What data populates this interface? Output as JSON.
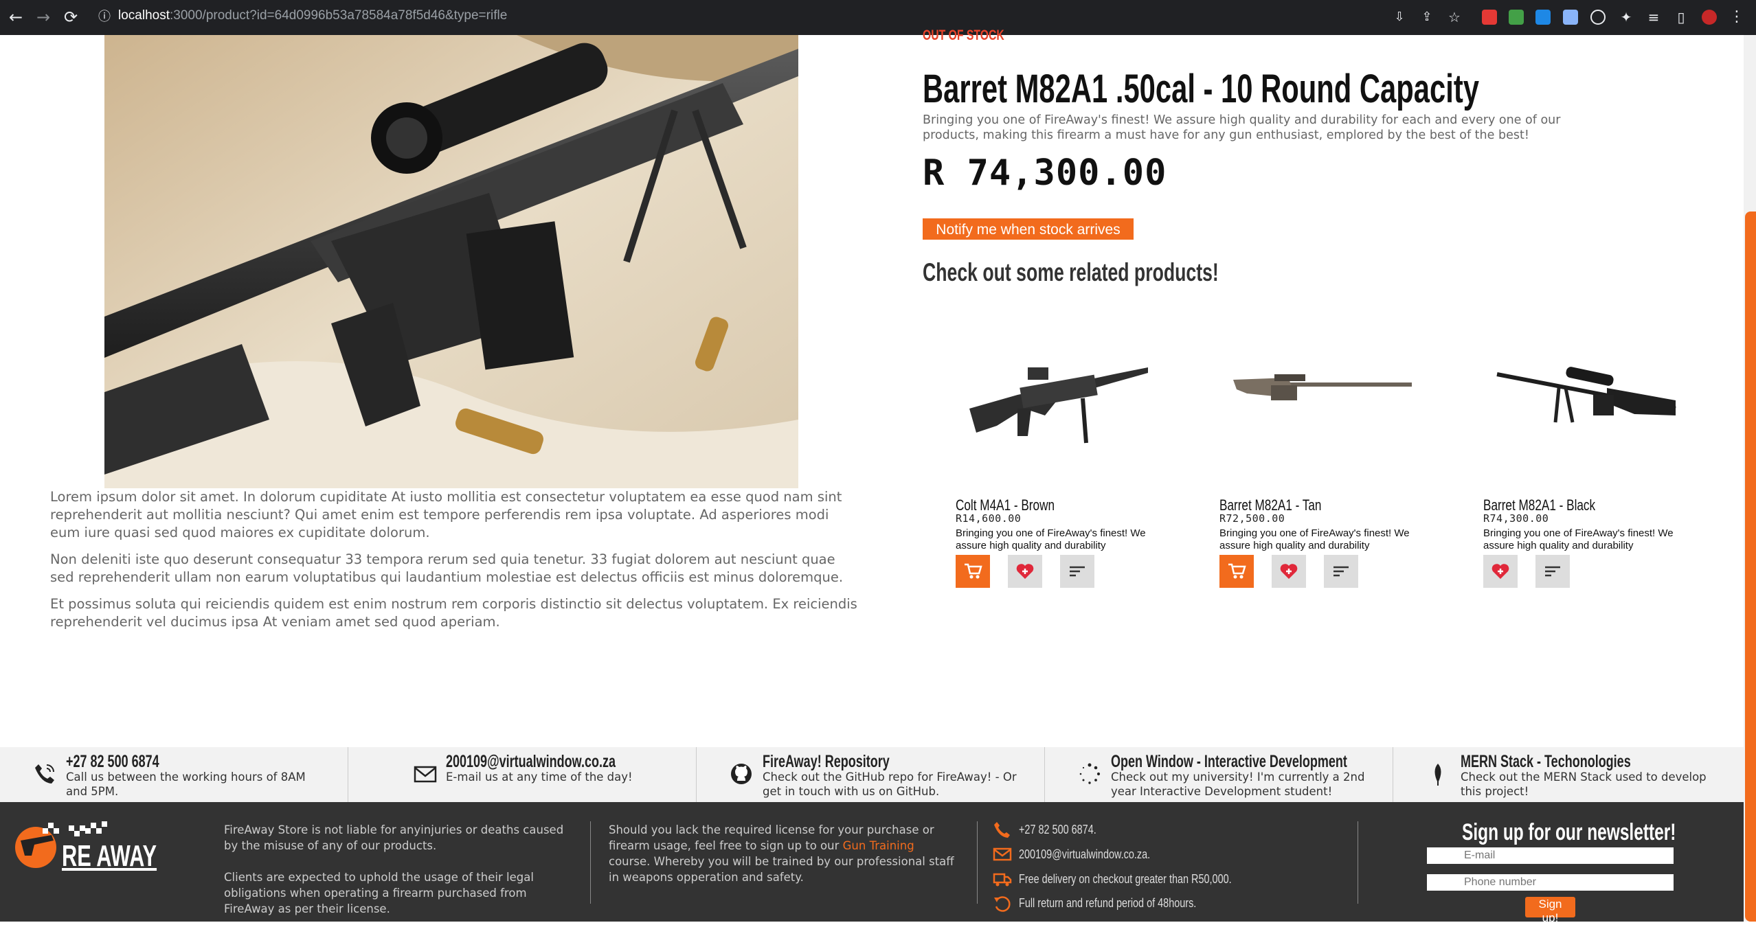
{
  "browser": {
    "url_host": "localhost",
    "url_path": ":3000/product?id=64d0996b53a78584a78f5d46&type=rifle"
  },
  "product": {
    "status": "OUT OF STOCK",
    "title": "Barret M82A1 .50cal - 10 Round Capacity",
    "description": "Bringing you one of FireAway's finest! We assure high quality and durability for each and every one of our products, making this firearm a must have for any gun enthusiast, emplored by the best of the best!",
    "price": "R 74,300.00",
    "notify_label": "Notify me when stock arrives",
    "long_description": [
      "Lorem ipsum dolor sit amet. In dolorum cupiditate At iusto mollitia est consectetur voluptatem ea esse quod nam sint reprehenderit aut mollitia nesciunt? Qui amet enim est tempore perferendis rem ipsa voluptate. Ad asperiores modi eum iure quasi sed quod maiores ex cupiditate dolorum.",
      "Non deleniti iste quo deserunt consequatur 33 tempora rerum sed quia tenetur. 33 fugiat dolorem aut nesciunt quae sed reprehenderit ullam non earum voluptatibus qui laudantium molestiae est delectus officiis est minus doloremque.",
      "Et possimus soluta qui reiciendis quidem est enim nostrum rem corporis distinctio sit delectus voluptatem. Ex reiciendis reprehenderit vel ducimus ipsa At veniam amet sed quod aperiam."
    ]
  },
  "related": {
    "heading": "Check out some related products!",
    "items": [
      {
        "name": "Colt M4A1 - Brown",
        "price": "R14,600.00",
        "desc": "Bringing you one of FireAway's finest! We assure high quality and durability"
      },
      {
        "name": "Barret M82A1 - Tan",
        "price": "R72,500.00",
        "desc": "Bringing you one of FireAway's finest! We assure high quality and durability"
      },
      {
        "name": "Barret M82A1 - Black",
        "price": "R74,300.00",
        "desc": "Bringing you one of FireAway's finest! We assure high quality and durability"
      }
    ]
  },
  "contacts": [
    {
      "title": "+27 82 500 6874",
      "desc": "Call us between the working hours of 8AM and 5PM.",
      "icon": "phone-icon"
    },
    {
      "title": "200109@virtualwindow.co.za",
      "desc": "E-mail us at any time of the day!",
      "icon": "mail-icon"
    },
    {
      "title": "FireAway! Repository",
      "desc": "Check out the GitHub repo for FireAway! - Or get in touch with us on GitHub.",
      "icon": "github-icon"
    },
    {
      "title": "Open Window - Interactive Development",
      "desc": "Check out my university! I'm currently a 2nd year Interactive Development student!",
      "icon": "loader-icon"
    },
    {
      "title": "MERN Stack - Techonologies",
      "desc": "Check out the MERN Stack used to develop this project!",
      "icon": "leaf-icon"
    }
  ],
  "footer": {
    "logo_text": "RE AWAY",
    "disclaimer_1": "FireAway Store is not liable for anyinjuries or deaths caused by the misuse of any of our products.",
    "disclaimer_2": "Clients are expected to uphold the usage of their legal obligations when operating a firearm purchased from FireAway as per their license.",
    "license_before": "Should you lack the required license for your purchase or firearm usage, feel free to sign up to our ",
    "license_link": "Gun Training",
    "license_after": " course. Whereby you will be trained by our professional staff in weapons opperation and safety.",
    "phone": "+27 82 500 6874.",
    "email": "200109@virtualwindow.co.za.",
    "delivery": "Free delivery on checkout greater than R50,000.",
    "returns": "Full return and refund period of 48hours.",
    "newsletter_heading": "Sign up for our newsletter!",
    "email_placeholder": "E-mail",
    "phone_placeholder": "Phone number",
    "signup_label": "Sign up!"
  },
  "colors": {
    "accent": "#f26b1d",
    "footer_bg": "#333333",
    "status_red": "#e8432b"
  }
}
